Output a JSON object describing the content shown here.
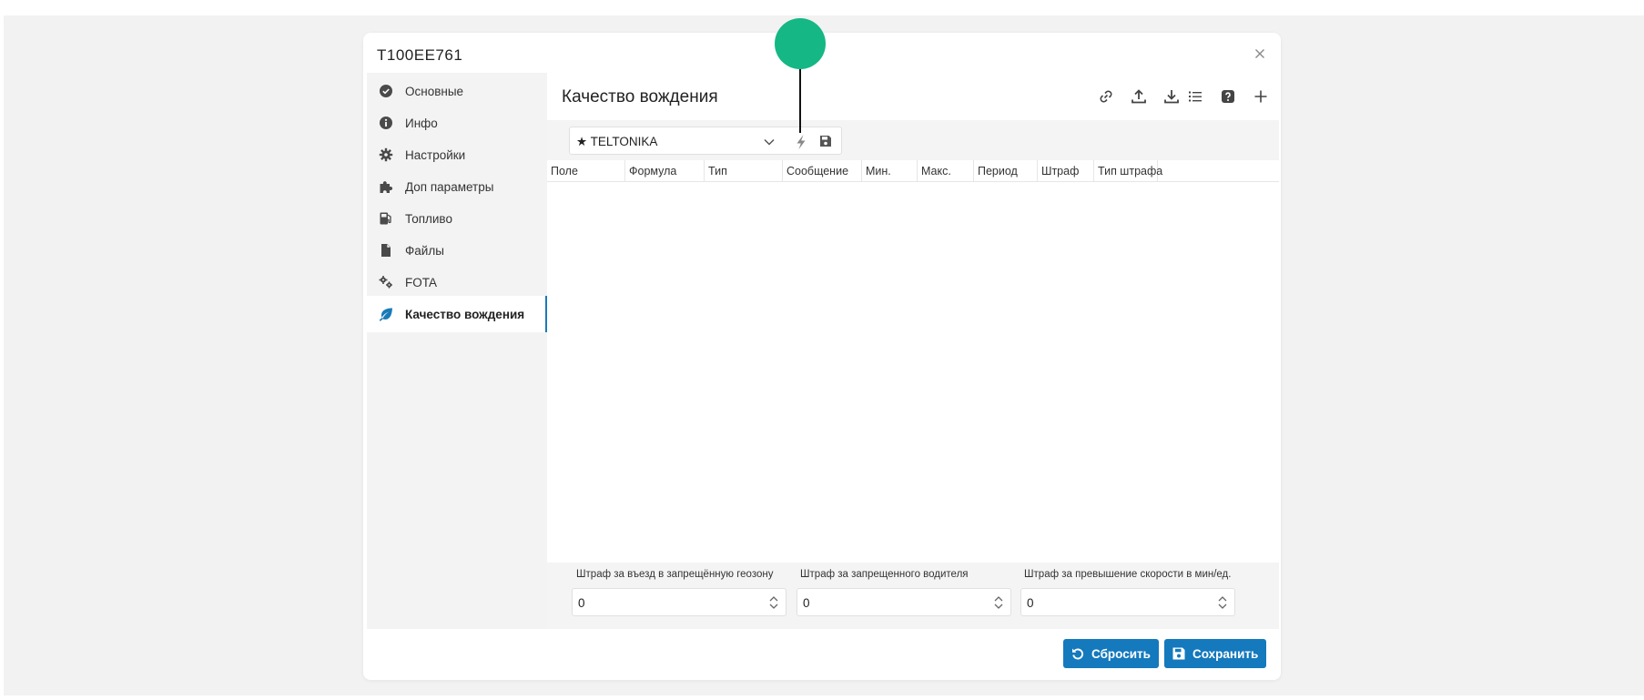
{
  "dialog": {
    "title": "Т100ЕЕ761"
  },
  "sidebar": {
    "items": [
      {
        "label": "Основные",
        "icon": "check-circle-icon"
      },
      {
        "label": "Инфо",
        "icon": "info-circle-icon"
      },
      {
        "label": "Настройки",
        "icon": "gear-icon"
      },
      {
        "label": "Доп параметры",
        "icon": "puzzle-icon"
      },
      {
        "label": "Топливо",
        "icon": "fuel-pump-icon"
      },
      {
        "label": "Файлы",
        "icon": "file-icon"
      },
      {
        "label": "FOTA",
        "icon": "gears-icon"
      },
      {
        "label": "Качество вождения",
        "icon": "leaf-icon",
        "active": true
      }
    ]
  },
  "main": {
    "title": "Качество вождения",
    "toolbar": [
      "link-icon",
      "upload-icon",
      "download-icon",
      "list-icon",
      "help-icon",
      "plus-icon"
    ],
    "preset": {
      "value": "★ TELTONIKA"
    },
    "columns": [
      "Поле",
      "Формула",
      "Тип",
      "Сообщение",
      "Мин.",
      "Макс.",
      "Период",
      "Штраф",
      "Тип штрафа"
    ]
  },
  "penalties": [
    {
      "label": "Штраф за въезд в запрещённую геозону",
      "value": "0"
    },
    {
      "label": "Штраф за запрещенного водителя",
      "value": "0"
    },
    {
      "label": "Штраф за превышение скорости в мин/ед.",
      "value": "0"
    }
  ],
  "actions": {
    "reset_label": "Сбросить",
    "save_label": "Сохранить"
  },
  "colors": {
    "accent": "#1479bd",
    "marker": "#15b785",
    "active_border": "#1a7ab8"
  }
}
